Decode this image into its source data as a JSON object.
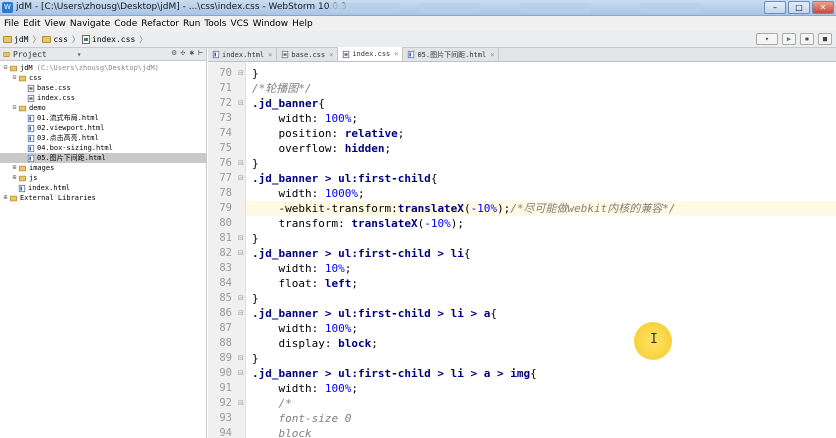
{
  "window": {
    "title": "jdM - [C:\\Users\\zhousg\\Desktop\\jdM] - ...\\css\\index.css - WebStorm 10.0.3",
    "minimize": "–",
    "maximize": "□",
    "close": "✕"
  },
  "menu": [
    "File",
    "Edit",
    "View",
    "Navigate",
    "Code",
    "Refactor",
    "Run",
    "Tools",
    "VCS",
    "Window",
    "Help"
  ],
  "breadcrumb": [
    "jdM",
    "css",
    "index.css"
  ],
  "project_panel": {
    "title": "Project",
    "tree": [
      {
        "indent": 0,
        "kind": "folder",
        "label": "jdM",
        "hint": "(C:\\Users\\zhousg\\Desktop\\jdM)",
        "expanded": true
      },
      {
        "indent": 1,
        "kind": "folder",
        "label": "css",
        "expanded": true
      },
      {
        "indent": 2,
        "kind": "css",
        "label": "base.css"
      },
      {
        "indent": 2,
        "kind": "css",
        "label": "index.css"
      },
      {
        "indent": 1,
        "kind": "folder",
        "label": "demo",
        "expanded": true
      },
      {
        "indent": 2,
        "kind": "html",
        "label": "01.流式布局.html"
      },
      {
        "indent": 2,
        "kind": "html",
        "label": "02.viewport.html"
      },
      {
        "indent": 2,
        "kind": "html",
        "label": "03.点击高亮.html"
      },
      {
        "indent": 2,
        "kind": "html",
        "label": "04.box-sizing.html"
      },
      {
        "indent": 2,
        "kind": "html",
        "label": "05.图片下间距.html",
        "selected": true
      },
      {
        "indent": 1,
        "kind": "folder",
        "label": "images",
        "expanded": false
      },
      {
        "indent": 1,
        "kind": "folder",
        "label": "js",
        "expanded": false
      },
      {
        "indent": 1,
        "kind": "html",
        "label": "index.html"
      },
      {
        "indent": 0,
        "kind": "folder",
        "label": "External Libraries",
        "expanded": false
      }
    ]
  },
  "editor_tabs": [
    {
      "label": "index.html",
      "kind": "html",
      "active": false
    },
    {
      "label": "base.css",
      "kind": "css",
      "active": false
    },
    {
      "label": "index.css",
      "kind": "css",
      "active": true
    },
    {
      "label": "05.图片下间距.html",
      "kind": "html",
      "active": false
    }
  ],
  "code_lines": [
    {
      "n": "70",
      "segs": [
        [
          "}",
          "plain"
        ]
      ],
      "fold": "⊟"
    },
    {
      "n": "71",
      "segs": [
        [
          "/*轮播图*/",
          "comment"
        ]
      ]
    },
    {
      "n": "72",
      "segs": [
        [
          ".jd_banner",
          "sel"
        ],
        [
          "{",
          "plain"
        ]
      ],
      "fold": "⊟"
    },
    {
      "n": "73",
      "segs": [
        [
          "    width: ",
          "prop"
        ],
        [
          "100%",
          "num"
        ],
        [
          ";",
          "plain"
        ]
      ]
    },
    {
      "n": "74",
      "segs": [
        [
          "    position: ",
          "prop"
        ],
        [
          "relative",
          "val"
        ],
        [
          ";",
          "plain"
        ]
      ]
    },
    {
      "n": "75",
      "segs": [
        [
          "    overflow: ",
          "prop"
        ],
        [
          "hidden",
          "val"
        ],
        [
          ";",
          "plain"
        ]
      ]
    },
    {
      "n": "76",
      "segs": [
        [
          "}",
          "plain"
        ]
      ],
      "fold": "⊟"
    },
    {
      "n": "77",
      "segs": [
        [
          ".jd_banner > ul:first-child",
          "sel"
        ],
        [
          "{",
          "plain"
        ]
      ],
      "fold": "⊟"
    },
    {
      "n": "78",
      "segs": [
        [
          "    width: ",
          "prop"
        ],
        [
          "1000%",
          "num"
        ],
        [
          ";",
          "plain"
        ]
      ]
    },
    {
      "n": "79",
      "segs": [
        [
          "    -webkit-transform:",
          "prop"
        ],
        [
          "translateX",
          "val"
        ],
        [
          "(",
          "plain"
        ],
        [
          "-10%",
          "num"
        ],
        [
          ");",
          "plain"
        ],
        [
          "/*尽可能做webkit内核的兼容*/",
          "comment"
        ]
      ],
      "highlight": true
    },
    {
      "n": "80",
      "segs": [
        [
          "    transform: ",
          "prop"
        ],
        [
          "translateX",
          "val"
        ],
        [
          "(",
          "plain"
        ],
        [
          "-10%",
          "num"
        ],
        [
          ");",
          "plain"
        ]
      ]
    },
    {
      "n": "81",
      "segs": [
        [
          "}",
          "plain"
        ]
      ],
      "fold": "⊟"
    },
    {
      "n": "82",
      "segs": [
        [
          ".jd_banner > ul:first-child > li",
          "sel"
        ],
        [
          "{",
          "plain"
        ]
      ],
      "fold": "⊟"
    },
    {
      "n": "83",
      "segs": [
        [
          "    width: ",
          "prop"
        ],
        [
          "10%",
          "num"
        ],
        [
          ";",
          "plain"
        ]
      ]
    },
    {
      "n": "84",
      "segs": [
        [
          "    float: ",
          "prop"
        ],
        [
          "left",
          "val"
        ],
        [
          ";",
          "plain"
        ]
      ]
    },
    {
      "n": "85",
      "segs": [
        [
          "}",
          "plain"
        ]
      ],
      "fold": "⊟"
    },
    {
      "n": "86",
      "segs": [
        [
          ".jd_banner > ul:first-child > li > a",
          "sel"
        ],
        [
          "{",
          "plain"
        ]
      ],
      "fold": "⊟"
    },
    {
      "n": "87",
      "segs": [
        [
          "    width: ",
          "prop"
        ],
        [
          "100%",
          "num"
        ],
        [
          ";",
          "plain"
        ]
      ]
    },
    {
      "n": "88",
      "segs": [
        [
          "    display: ",
          "prop"
        ],
        [
          "block",
          "val"
        ],
        [
          ";",
          "plain"
        ]
      ]
    },
    {
      "n": "89",
      "segs": [
        [
          "}",
          "plain"
        ]
      ],
      "fold": "⊟"
    },
    {
      "n": "90",
      "segs": [
        [
          ".jd_banner > ul:first-child > li > a > img",
          "sel"
        ],
        [
          "{",
          "plain"
        ]
      ],
      "fold": "⊟"
    },
    {
      "n": "91",
      "segs": [
        [
          "    width: ",
          "prop"
        ],
        [
          "100%",
          "num"
        ],
        [
          ";",
          "plain"
        ]
      ]
    },
    {
      "n": "92",
      "segs": [
        [
          "    /*",
          "comment"
        ]
      ],
      "fold": "⊟"
    },
    {
      "n": "93",
      "segs": [
        [
          "    font-size 0",
          "comment"
        ]
      ]
    },
    {
      "n": "94",
      "segs": [
        [
          "    block",
          "comment"
        ]
      ]
    }
  ],
  "cursor_glyph": "I",
  "colors": {
    "selector": "#000080",
    "number": "#0000ff",
    "comment": "#808080",
    "current_line": "#fffae3",
    "cursor_highlight": "#f4c617"
  }
}
